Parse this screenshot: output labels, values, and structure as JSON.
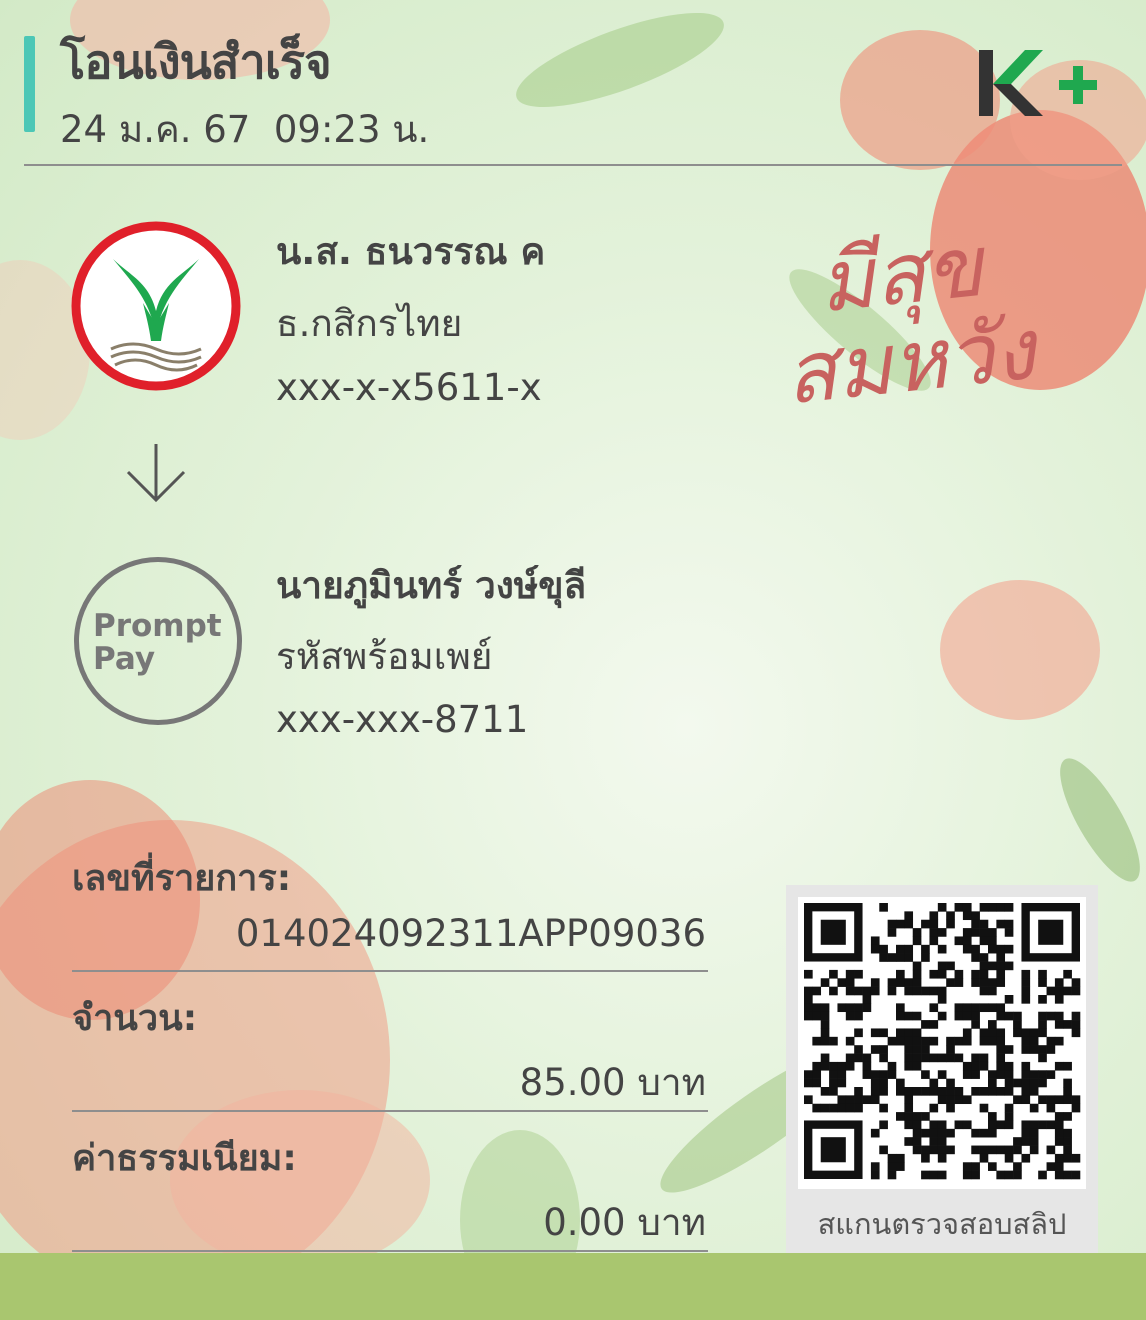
{
  "header": {
    "title": "โอนเงินสำเร็จ",
    "datetime": "24 ม.ค. 67  09:23 น.",
    "brand_logo": "K+"
  },
  "sender": {
    "name": "น.ส. ธนวรรณ ค",
    "bank": "ธ.กสิกรไทย",
    "account": "xxx-x-x5611-x",
    "icon": "kasikornbank-logo-icon"
  },
  "arrow_icon": "arrow-down-icon",
  "receiver": {
    "name": "นายภูมินทร์ วงษ์ขุลี",
    "bank": "รหัสพร้อมเพย์",
    "account": "xxx-xxx-8711",
    "icon_text_1": "Prompt",
    "icon_text_2": "Pay"
  },
  "details": {
    "ref_label": "เลขที่รายการ:",
    "ref_value": "014024092311APP09036",
    "amount_label": "จำนวน:",
    "amount_value": "85.00 บาท",
    "fee_label": "ค่าธรรมเนียม:",
    "fee_value": "0.00 บาท"
  },
  "qr": {
    "caption": "สแกนตรวจสอบสลิป"
  },
  "decoration": {
    "greeting_line1": "มีสุข",
    "greeting_line2": "สมหวัง"
  },
  "colors": {
    "accent": "#4cc7b6",
    "kbank_green": "#1fa84f",
    "kbank_red": "#e0202a",
    "footer": "#a9c66f"
  }
}
